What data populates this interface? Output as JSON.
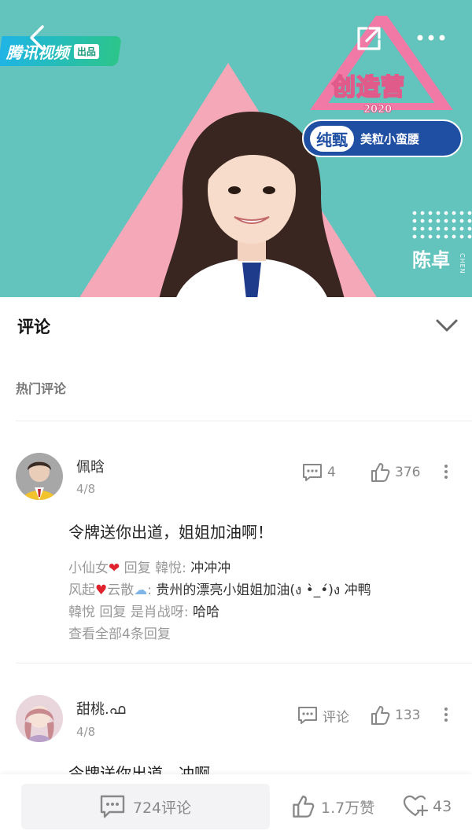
{
  "video": {
    "platform_logo": "腾讯视频",
    "platform_tag": "出品",
    "show_title": "创造营",
    "show_year": "2020",
    "sponsor_brand": "纯甄",
    "sponsor_name": "美粒小蛮腰",
    "contestant_name": "陈卓",
    "contestant_pinyin": "CHEN",
    "icons": [
      "back-arrow-icon",
      "share-icon",
      "more-horizontal-icon"
    ],
    "colors": {
      "background": "#63c3bd",
      "triangle": "#f4a8b8"
    }
  },
  "panel": {
    "title": "评论",
    "section_title": "热门评论"
  },
  "comments": [
    {
      "username": "佩晗",
      "date": "4/8",
      "reply_count": "4",
      "like_count": "376",
      "text": "令牌送你出道，姐姐加油啊！",
      "replies": [
        {
          "from": "小仙女",
          "from_emoji": "❤️",
          "action": "回复",
          "to": "韓悅",
          "text": "冲冲冲"
        },
        {
          "from": "风起",
          "from_emoji": "💗",
          "from2": "云散",
          "from2_emoji": "☁️",
          "text": "贵州的漂亮小姐姐加油(ง •̀_•́)ง 冲鸭"
        },
        {
          "from": "韓悅",
          "action": "回复",
          "to": "是肖战呀",
          "text": "哈哈"
        }
      ],
      "view_all": "查看全部4条回复"
    },
    {
      "username": "甜桃.ഫ",
      "date": "4/8",
      "reply_label": "评论",
      "like_count": "133",
      "text": "令牌送你出道，冲啊"
    }
  ],
  "bottom_bar": {
    "comment_count": "724评论",
    "like_count": "1.7万赞",
    "favorite_count": "43"
  }
}
